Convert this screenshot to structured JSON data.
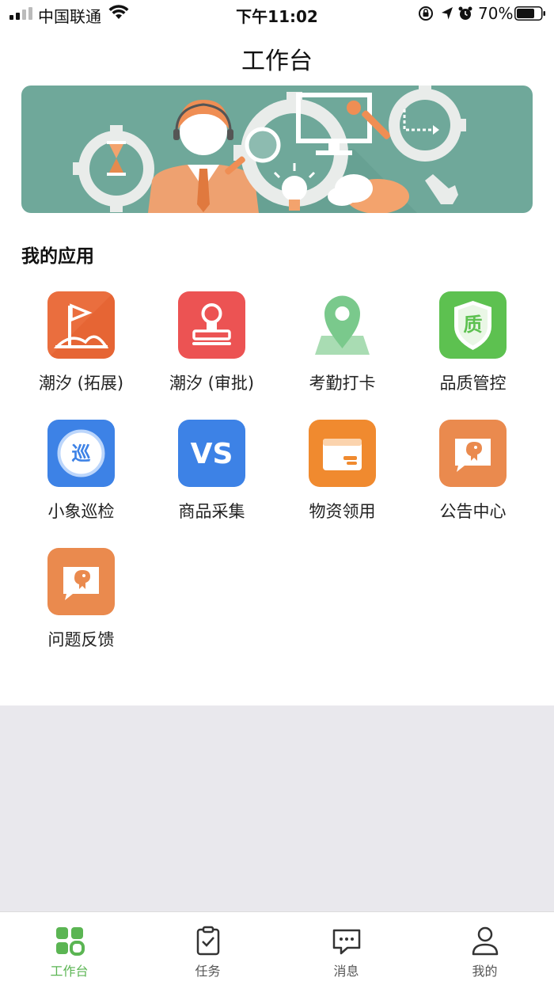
{
  "status_bar": {
    "carrier": "中国联通",
    "time": "下午11:02",
    "battery": "70%"
  },
  "nav": {
    "title": "工作台"
  },
  "section_title": "我的应用",
  "apps": [
    {
      "label": "潮汐 (拓展)",
      "icon": "flag-icon",
      "color": "#ea6e3e"
    },
    {
      "label": "潮汐 (审批)",
      "icon": "stamp-icon",
      "color": "#ec5353"
    },
    {
      "label": "考勤打卡",
      "icon": "location-pin-icon",
      "color": "#7ac98c"
    },
    {
      "label": "品质管控",
      "icon": "quality-shield-icon",
      "shield_text": "质",
      "color": "#5dc150"
    },
    {
      "label": "小象巡检",
      "icon": "patrol-icon",
      "badge_text": "巡",
      "color": "#3d82e6"
    },
    {
      "label": "商品采集",
      "icon": "vs-icon",
      "badge_text": "VS",
      "color": "#3d82e6"
    },
    {
      "label": "物资领用",
      "icon": "wallet-box-icon",
      "color": "#f08a2f"
    },
    {
      "label": "公告中心",
      "icon": "elephant-message-icon",
      "color": "#ea8a4e"
    },
    {
      "label": "问题反馈",
      "icon": "elephant-message-icon",
      "color": "#ea8a4e"
    }
  ],
  "tabs": [
    {
      "label": "工作台",
      "icon": "dashboard-icon",
      "active": true
    },
    {
      "label": "任务",
      "icon": "clipboard-check-icon",
      "active": false
    },
    {
      "label": "消息",
      "icon": "chat-bubble-icon",
      "active": false
    },
    {
      "label": "我的",
      "icon": "person-icon",
      "active": false
    }
  ],
  "colors": {
    "accent": "#5bb553",
    "banner_bg": "#6fa89a",
    "gray_area": "#e9e8ed"
  }
}
